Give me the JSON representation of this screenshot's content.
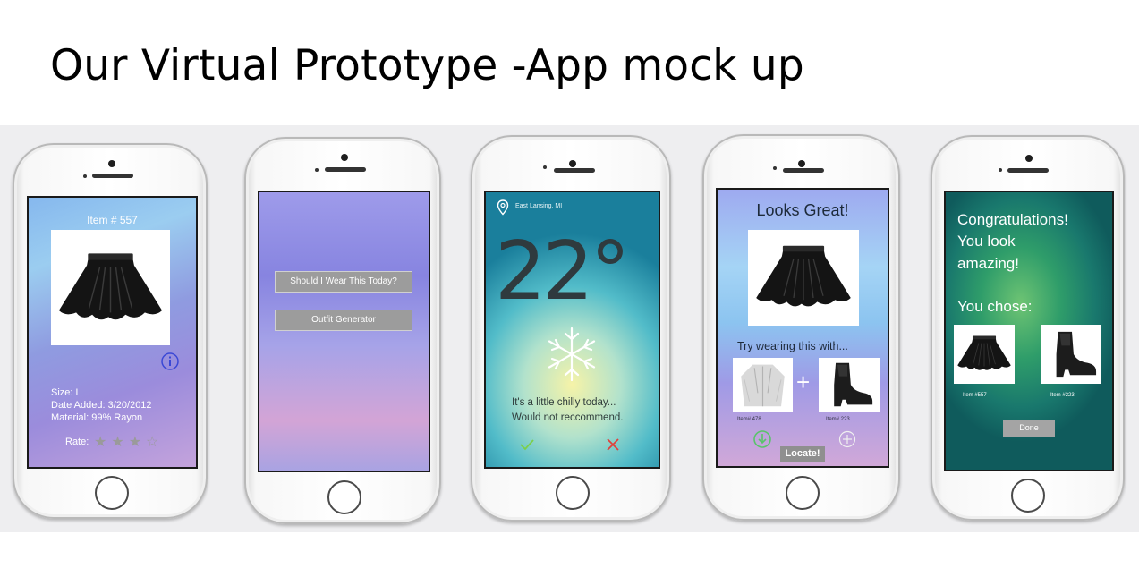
{
  "slide": {
    "title": "Our Virtual Prototype -App mock up"
  },
  "screen1": {
    "item_title": "Item # 557",
    "info_icon": "info-icon",
    "size": "Size: L",
    "date_added": "Date Added: 3/20/2012",
    "material": "Material: 99% Rayon",
    "rate_label": "Rate:",
    "rating": 3,
    "rating_max": 4
  },
  "screen2": {
    "button1_label": "Should I Wear This Today?",
    "button2_label": "Outfit Generator"
  },
  "screen3": {
    "location": "East Lansing, MI",
    "location_icon": "map-pin-icon",
    "temperature": "22°",
    "weather_icon": "snowflake-icon",
    "message_line1": "It's a little chilly today...",
    "message_line2": "Would not reccommend.",
    "accept_icon": "checkmark-icon",
    "reject_icon": "x-icon"
  },
  "screen4": {
    "heading": "Looks Great!",
    "suggestion": "Try wearing this with...",
    "item1_caption": "Item# 478",
    "item2_caption": "Item# 223",
    "locate_label": "Locate!",
    "download_icon": "download-icon",
    "add_icon": "plus-circle-icon"
  },
  "screen5": {
    "line1": "Congratulations!",
    "line2": "You look",
    "line3": "amazing!",
    "chose": "You chose:",
    "item1_caption": "Item #557",
    "item2_caption": "Item #223",
    "done_label": "Done"
  },
  "colors": {
    "check_green": "#7ccf4a",
    "x_red": "#e0413b",
    "band_gray": "#eeeef0"
  }
}
